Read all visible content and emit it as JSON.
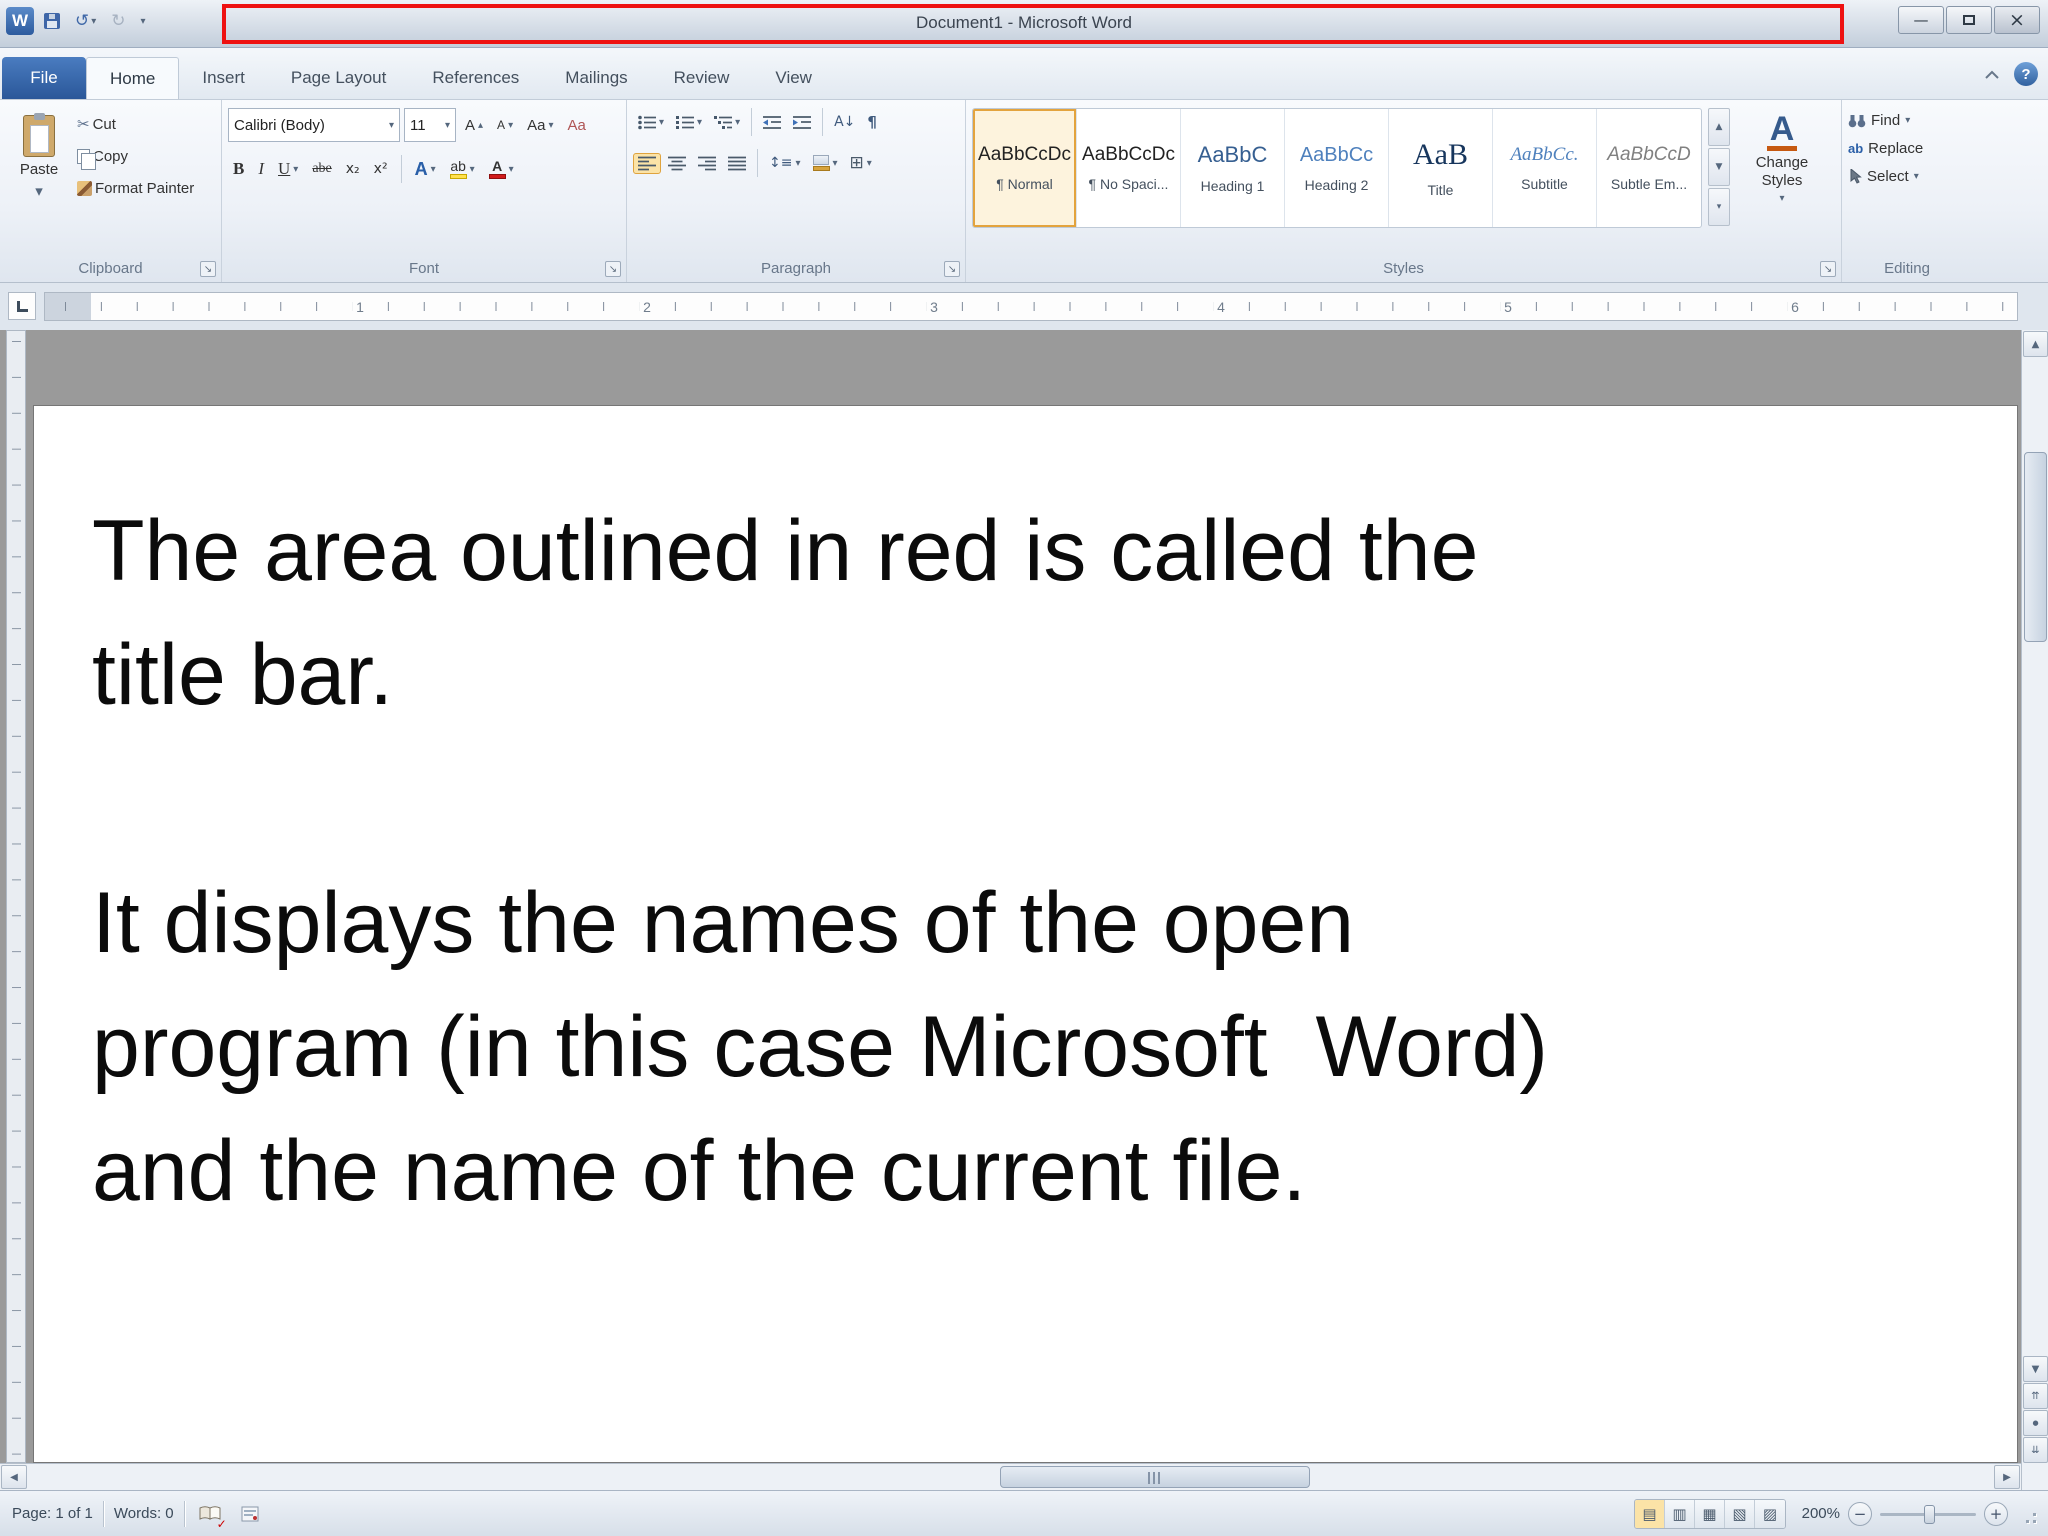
{
  "window": {
    "title": "Document1 - Microsoft Word"
  },
  "icons": {
    "word_logo": "W",
    "dropdown": "▾",
    "small_up": "▴",
    "undo": "↺",
    "redo": "↻",
    "minimize": "—",
    "close": "×",
    "help": "?",
    "cut": "✂",
    "pilcrow": "¶",
    "line_spacing": "↕≡",
    "borders_grid": "⊞",
    "sort": "A↓",
    "scroll_up": "▲",
    "scroll_down": "▼",
    "scroll_left": "◀",
    "scroll_right": "▶",
    "prev_page": "⇈",
    "next_page": "⇊",
    "browse": "●",
    "launcher": "↘",
    "replace_ab": "ab",
    "spell_check": "✓",
    "views": [
      "▤",
      "▥",
      "▦",
      "▧",
      "▨"
    ],
    "zoom_out": "−",
    "zoom_in": "+"
  },
  "tabs": {
    "file": "File",
    "items": [
      "Home",
      "Insert",
      "Page Layout",
      "References",
      "Mailings",
      "Review",
      "View"
    ]
  },
  "clipboard_group": {
    "label": "Clipboard",
    "paste": "Paste",
    "cut": "Cut",
    "copy": "Copy",
    "format_painter": "Format Painter"
  },
  "font_group": {
    "label": "Font",
    "font_name": "Calibri (Body)",
    "font_size": "11",
    "bold": "B",
    "italic": "I",
    "underline": "U",
    "strikethrough": "abe",
    "subscript": "x₂",
    "superscript": "x²",
    "grow_font": "A",
    "shrink_font": "A",
    "change_case": "Aa",
    "clear_formatting": "Aa",
    "text_effects": "A",
    "highlight": "ab",
    "font_color": "A"
  },
  "paragraph_group": {
    "label": "Paragraph"
  },
  "styles_group": {
    "label": "Styles",
    "change_styles": "Change Styles",
    "items": [
      {
        "preview": "AaBbCcDc",
        "name": "¶ Normal"
      },
      {
        "preview": "AaBbCcDc",
        "name": "¶ No Spaci..."
      },
      {
        "preview": "AaBbC",
        "name": "Heading 1"
      },
      {
        "preview": "AaBbCc",
        "name": "Heading 2"
      },
      {
        "preview": "AaB",
        "name": "Title"
      },
      {
        "preview": "AaBbCc.",
        "name": "Subtitle"
      },
      {
        "preview": "AaBbCcD",
        "name": "Subtle Em..."
      }
    ]
  },
  "editing_group": {
    "label": "Editing",
    "find": "Find",
    "replace": "Replace",
    "select": "Select"
  },
  "ruler": {
    "numbers": [
      "1",
      "2",
      "3",
      "4",
      "5",
      "6"
    ]
  },
  "document": {
    "lines": [
      "The area outlined in red is called the",
      "title bar.",
      "",
      "It displays the names of the open",
      "program (in this case Microsoft  Word)",
      "and the name of the current file."
    ]
  },
  "status_bar": {
    "page": "Page: 1 of 1",
    "words": "Words: 0",
    "zoom": "200%"
  },
  "colors": {
    "outline_red": "#ee1111",
    "file_tab_blue": "#3a6db5",
    "style_selected_border": "#e3a33d"
  }
}
